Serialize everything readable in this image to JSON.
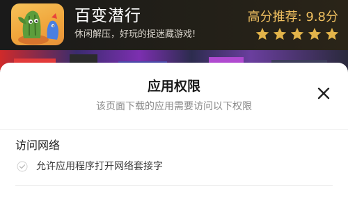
{
  "app": {
    "name": "百变潜行",
    "description": "休闲解压，好玩的捉迷藏游戏!",
    "rating_label": "高分推荐: 9.8分",
    "star_count": 5,
    "star_color": "#e3b44a"
  },
  "sheet": {
    "title": "应用权限",
    "subtitle": "该页面下载的应用需要访问以下权限",
    "close_icon": "close-icon"
  },
  "permissions": [
    {
      "group": "访问网络",
      "items": [
        "允许应用程序打开网络套接字"
      ]
    }
  ]
}
